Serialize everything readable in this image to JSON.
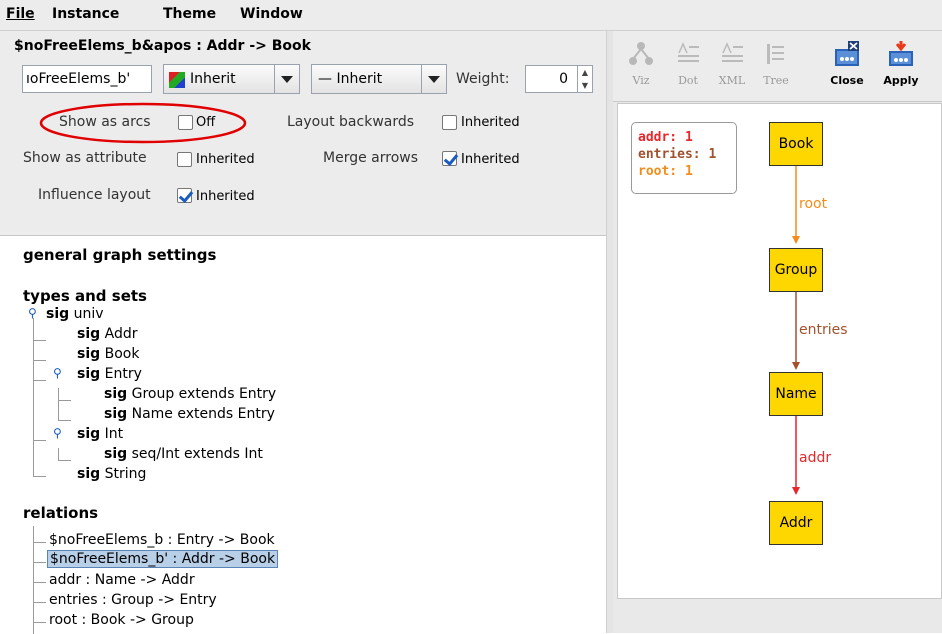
{
  "menu": [
    "File",
    "Instance",
    "Theme",
    "Window"
  ],
  "relation_editor": {
    "heading": "$noFreeElems_b&apos : Addr -> Book",
    "name_value": "ıoFreeElems_b'",
    "color_value": "Inherit",
    "style_value": "— Inherit",
    "weight_label": "Weight:",
    "weight_value": "0",
    "show_as_arcs": {
      "label": "Show as arcs",
      "value": "Off"
    },
    "layout_backwards": {
      "label": "Layout backwards",
      "value": "Inherited"
    },
    "show_as_attribute": {
      "label": "Show as attribute",
      "value": "Inherited"
    },
    "merge_arrows": {
      "label": "Merge arrows",
      "value": "Inherited",
      "checked": true
    },
    "influence_layout": {
      "label": "Influence layout",
      "value": "Inherited",
      "checked": true
    }
  },
  "tree": {
    "general": "general graph settings",
    "types_heading": "types and sets",
    "types": [
      {
        "kw": "sig",
        "name": "univ"
      },
      {
        "kw": "sig",
        "name": "Addr"
      },
      {
        "kw": "sig",
        "name": "Book"
      },
      {
        "kw": "sig",
        "name": "Entry"
      },
      {
        "kw": "sig",
        "name": "Group extends Entry"
      },
      {
        "kw": "sig",
        "name": "Name extends Entry"
      },
      {
        "kw": "sig",
        "name": "Int"
      },
      {
        "kw": "sig",
        "name": "seq/Int extends Int"
      },
      {
        "kw": "sig",
        "name": "String"
      }
    ],
    "relations_heading": "relations",
    "relations": [
      "$noFreeElems_b :  Entry -> Book",
      "$noFreeElems_b' :  Addr -> Book",
      "addr :  Name -> Addr",
      "entries :  Group -> Entry",
      "root :  Book -> Group"
    ],
    "selected_relation": 1
  },
  "toolbar": [
    {
      "label": "Viz",
      "icon": "viz-icon",
      "enabled": false
    },
    {
      "label": "Dot",
      "icon": "dot-icon",
      "enabled": false
    },
    {
      "label": "XML",
      "icon": "xml-icon",
      "enabled": false
    },
    {
      "label": "Tree",
      "icon": "tree-icon",
      "enabled": false
    },
    {
      "label": "Close",
      "icon": "close-theme-icon",
      "enabled": true
    },
    {
      "label": "Apply",
      "icon": "apply-theme-icon",
      "enabled": true
    }
  ],
  "graph": {
    "legend": [
      {
        "text": "addr: 1",
        "color": "#e8262b"
      },
      {
        "text": "entries: 1",
        "color": "#a0522d"
      },
      {
        "text": "root: 1",
        "color": "#f28c1a"
      }
    ],
    "nodes": [
      "Book",
      "Group",
      "Name",
      "Addr"
    ],
    "edges": [
      {
        "label": "root",
        "color": "#f28c1a"
      },
      {
        "label": "entries",
        "color": "#a0522d"
      },
      {
        "label": "addr",
        "color": "#e8262b"
      }
    ]
  },
  "colors": {
    "node_fill": "#ffd700",
    "selection": "#b8cfe8",
    "highlight_ellipse": "#e00000"
  }
}
